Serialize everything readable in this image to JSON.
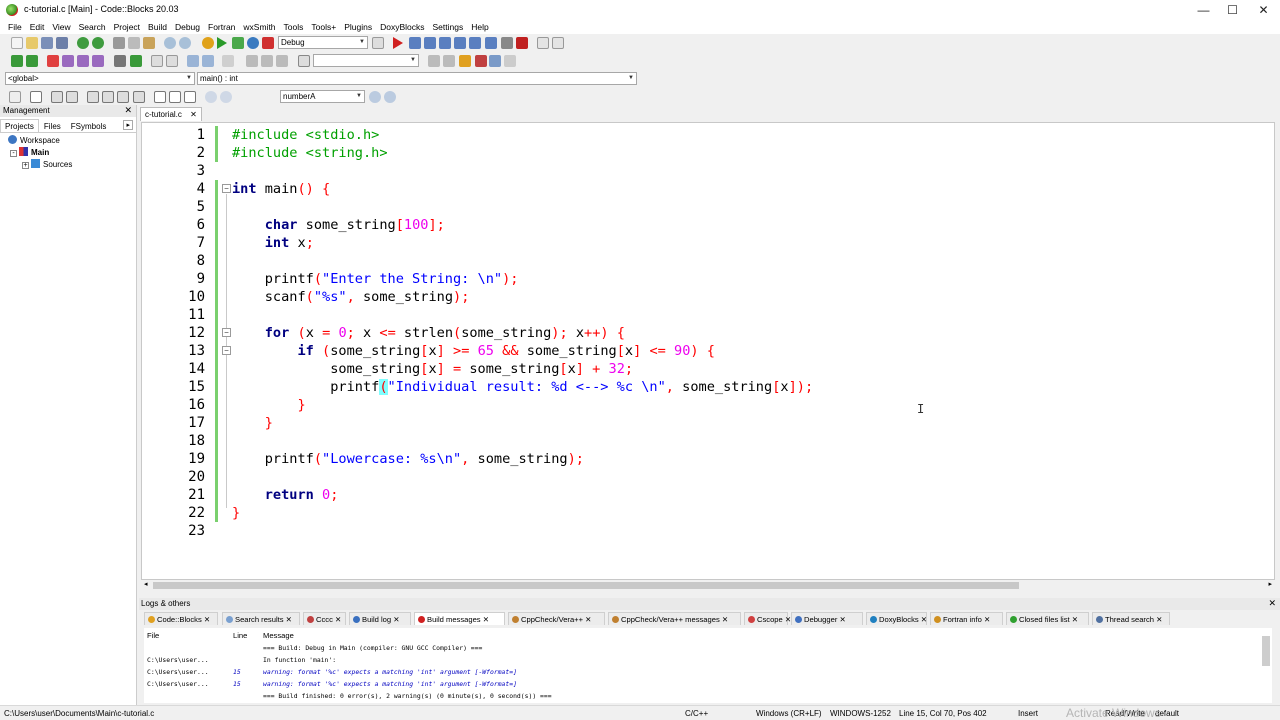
{
  "window": {
    "title": "c-tutorial.c [Main] - Code::Blocks 20.03",
    "minimize": "—",
    "maximize": "☐",
    "close": "✕"
  },
  "menu": [
    "File",
    "Edit",
    "View",
    "Search",
    "Project",
    "Build",
    "Debug",
    "Fortran",
    "wxSmith",
    "Tools",
    "Tools+",
    "Plugins",
    "DoxyBlocks",
    "Settings",
    "Help"
  ],
  "toolbar": {
    "build_target": "Debug",
    "scope": "<global>",
    "symbol": "main() : int",
    "search_symbol": "numberA",
    "bold_s": "S",
    "c_glyph": "C"
  },
  "management": {
    "title": "Management",
    "close": "✕",
    "tabs": [
      "Projects",
      "Files",
      "FSymbols"
    ],
    "tree": {
      "workspace": "Workspace",
      "project": "Main",
      "folder": "Sources"
    }
  },
  "editor": {
    "tab_label": "c-tutorial.c",
    "tab_close": "✕",
    "line_numbers": [
      "1",
      "2",
      "3",
      "4",
      "5",
      "6",
      "7",
      "8",
      "9",
      "10",
      "11",
      "12",
      "13",
      "14",
      "15",
      "16",
      "17",
      "18",
      "19",
      "20",
      "21",
      "22",
      "23"
    ],
    "lines": [
      "#include <stdio.h>",
      "#include <string.h>",
      "",
      "int main() {",
      "",
      "    char some_string[100];",
      "    int x;",
      "",
      "    printf(\"Enter the String: \\n\");",
      "    scanf(\"%s\", some_string);",
      "",
      "    for (x = 0; x <= strlen(some_string); x++) {",
      "        if (some_string[x] >= 65 && some_string[x] <= 90) {",
      "            some_string[x] = some_string[x] + 32;",
      "            printf(\"Individual result: %d <--> %c \\n\", some_string[x]);",
      "        }",
      "    }",
      "",
      "    printf(\"Lowercase: %s\\n\", some_string);",
      "",
      "    return 0;",
      "}",
      ""
    ]
  },
  "logs": {
    "title": "Logs & others",
    "close": "✕",
    "tabs": [
      "Code::Blocks",
      "Search results",
      "Cccc",
      "Build log",
      "Build messages",
      "CppCheck/Vera++",
      "CppCheck/Vera++ messages",
      "Cscope",
      "Debugger",
      "DoxyBlocks",
      "Fortran info",
      "Closed files list",
      "Thread search"
    ],
    "active_tab": "Build messages",
    "columns": {
      "file": "File",
      "line": "Line",
      "message": "Message"
    },
    "rows": [
      {
        "file": "",
        "line": "",
        "message": "=== Build: Debug in Main (compiler: GNU GCC Compiler) ===",
        "warning": false
      },
      {
        "file": "C:\\Users\\user...",
        "line": "",
        "message": "In function 'main':",
        "warning": false
      },
      {
        "file": "C:\\Users\\user...",
        "line": "15",
        "message": "warning: format '%c' expects a matching 'int' argument [-Wformat=]",
        "warning": true
      },
      {
        "file": "C:\\Users\\user...",
        "line": "15",
        "message": "warning: format '%c' expects a matching 'int' argument [-Wformat=]",
        "warning": true
      },
      {
        "file": "",
        "line": "",
        "message": "=== Build finished: 0 error(s), 2 warning(s) (0 minute(s), 0 second(s)) ===",
        "warning": false
      }
    ]
  },
  "status": {
    "path": "C:\\Users\\user\\Documents\\Main\\c-tutorial.c",
    "language": "C/C++",
    "eol": "Windows (CR+LF)",
    "encoding": "WINDOWS-1252",
    "position": "Line 15, Col 70, Pos 402",
    "mode": "Insert",
    "access": "Read/Write",
    "profile": "default"
  },
  "watermark": "Activate Windows"
}
